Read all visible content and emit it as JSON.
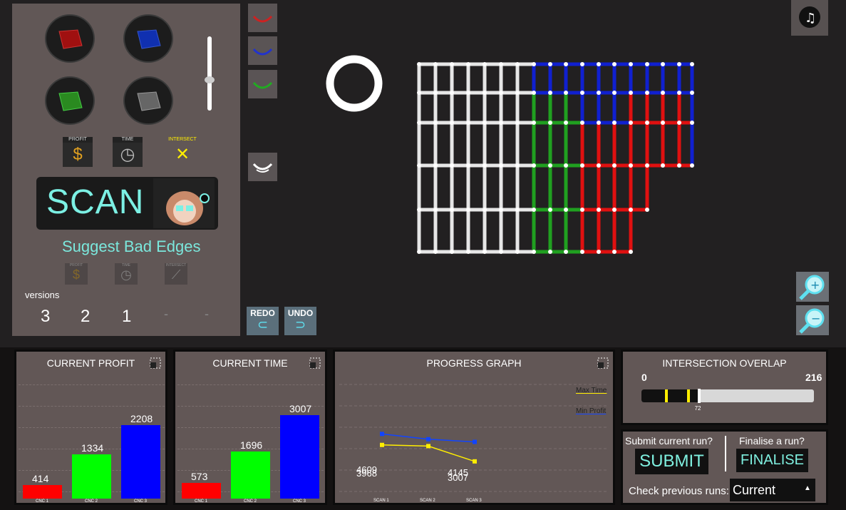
{
  "left_panel": {
    "metrics": [
      {
        "label": "PROFIT",
        "icon": "dollar-icon"
      },
      {
        "label": "TIME",
        "icon": "stopwatch-icon"
      },
      {
        "label": "INTERSECT",
        "icon": "intersect-icon"
      }
    ],
    "dim_metrics": [
      {
        "label": "PROFIT",
        "icon": "dollar-icon"
      },
      {
        "label": "TIME",
        "icon": "stopwatch-icon"
      },
      {
        "label": "INTERSECT",
        "icon": "intersect-icon"
      }
    ],
    "scan_label": "SCAN",
    "suggest_label": "Suggest Bad Edges",
    "versions_label": "versions",
    "versions": [
      "3",
      "2",
      "1",
      "-",
      "-"
    ]
  },
  "tools": {
    "redo_label": "REDO",
    "undo_label": "UNDO"
  },
  "profit_panel": {
    "title": "CURRENT PROFIT",
    "bars": [
      {
        "cat": "CNC 1",
        "value": 414,
        "color": "#ff0000"
      },
      {
        "cat": "CNC 2",
        "value": 1334,
        "color": "#00ff00"
      },
      {
        "cat": "CNC 3",
        "value": 2208,
        "color": "#0000ff"
      }
    ]
  },
  "time_panel": {
    "title": "CURRENT TIME",
    "bars": [
      {
        "cat": "CNC 1",
        "value": 573,
        "color": "#ff0000"
      },
      {
        "cat": "CNC 2",
        "value": 1696,
        "color": "#00ff00"
      },
      {
        "cat": "CNC 3",
        "value": 3007,
        "color": "#0000ff"
      }
    ]
  },
  "progress_panel": {
    "title": "PROGRESS GRAPH",
    "legend": [
      {
        "name": "Max Time",
        "color": "#ffee00"
      },
      {
        "name": "Min Profit",
        "color": "#1144ff"
      }
    ],
    "x": [
      "SCAN 1",
      "SCAN 2",
      "SCAN 3"
    ],
    "labels": [
      "4609",
      "3968",
      "4145",
      "3007"
    ]
  },
  "chart_data": {
    "type": "line",
    "title": "PROGRESS GRAPH",
    "x": [
      "SCAN 1",
      "SCAN 2",
      "SCAN 3"
    ],
    "series": [
      {
        "name": "Max Time",
        "values": [
          3968,
          3900,
          3007
        ]
      },
      {
        "name": "Min Profit",
        "values": [
          4609,
          4300,
          4145
        ]
      }
    ]
  },
  "intersection_panel": {
    "title": "INTERSECTION OVERLAP",
    "min": "0",
    "max": "216",
    "current": "72",
    "fraction": 0.333
  },
  "submit_panel": {
    "submit_question": "Submit current run?",
    "submit_label": "SUBMIT",
    "finalise_question": "Finalise a run?",
    "finalise_label": "FINALISE",
    "check_label": "Check previous runs:",
    "select_value": "Current"
  },
  "colors": {
    "accent": "#7cf0e4",
    "red": "#ff0000",
    "green": "#00ff00",
    "blue": "#0000ff"
  }
}
